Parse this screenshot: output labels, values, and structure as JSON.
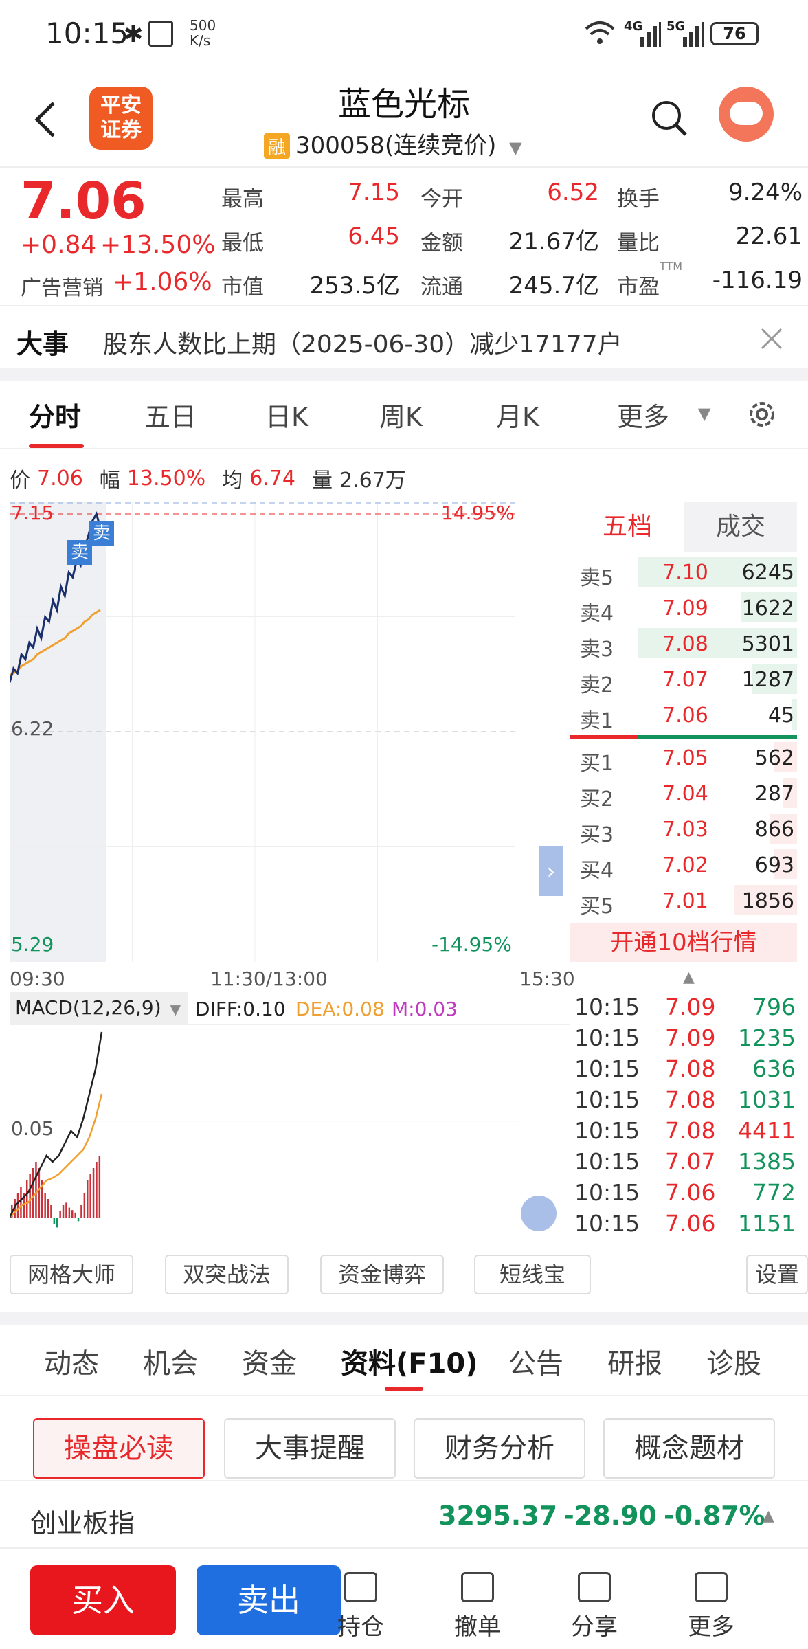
{
  "status_bar": {
    "time": "10:15",
    "net_speed": "500\nK/s",
    "network": "4G 5G",
    "battery": "76"
  },
  "header": {
    "logo_text": "平安\n证券",
    "title": "蓝色光标",
    "margin_badge": "融",
    "code": "300058",
    "trade_state": "(连续竞价)"
  },
  "quote": {
    "price": "7.06",
    "change": "+0.84",
    "change_pct": "+13.50%",
    "sector_name": "广告营销",
    "sector_pct": "+1.06%",
    "stats": [
      {
        "label": "最高",
        "value": "7.15",
        "color": "#e8282b"
      },
      {
        "label": "今开",
        "value": "6.52",
        "color": "#e8282b"
      },
      {
        "label": "换手",
        "value": "9.24%",
        "color": "#222222"
      },
      {
        "label": "最低",
        "value": "6.45",
        "color": "#e8282b"
      },
      {
        "label": "金额",
        "value": "21.67亿",
        "color": "#222222"
      },
      {
        "label": "量比",
        "value": "22.61",
        "color": "#222222"
      },
      {
        "label": "市值",
        "value": "253.5亿",
        "color": "#222222"
      },
      {
        "label": "流通",
        "value": "245.7亿",
        "color": "#222222"
      },
      {
        "label": "市盈",
        "value": "-116.19",
        "color": "#222222"
      }
    ],
    "ttm": "TTM"
  },
  "news": {
    "label": "大事",
    "text": "股东人数比上期（2025-06-30）减少17177户"
  },
  "chart_tabs": {
    "items": [
      "分时",
      "五日",
      "日K",
      "周K",
      "月K",
      "更多"
    ],
    "active": 0
  },
  "info_line": {
    "price_label": "价",
    "price": "7.06",
    "pct_label": "幅",
    "pct": "13.50%",
    "avg_label": "均",
    "avg": "6.74",
    "vol_label": "量",
    "vol": "2.67万"
  },
  "chart_data": {
    "type": "line",
    "y_labels": {
      "top": "7.15",
      "mid": "6.22",
      "bottom": "5.29",
      "top_pct": "14.95%",
      "bottom_pct": "-14.95%"
    },
    "x_labels": [
      "09:30",
      "11:30/13:00",
      "15:30"
    ],
    "ylim": [
      5.29,
      7.15
    ],
    "price": [
      6.43,
      6.49,
      6.47,
      6.55,
      6.53,
      6.6,
      6.58,
      6.66,
      6.62,
      6.71,
      6.69,
      6.78,
      6.74,
      6.84,
      6.8,
      6.9,
      6.88,
      6.95,
      6.93,
      7.0,
      7.06,
      7.12,
      7.15,
      7.09
    ],
    "avg": [
      6.46,
      6.47,
      6.48,
      6.5,
      6.51,
      6.52,
      6.53,
      6.55,
      6.56,
      6.57,
      6.58,
      6.59,
      6.6,
      6.61,
      6.62,
      6.64,
      6.65,
      6.66,
      6.67,
      6.69,
      6.7,
      6.72,
      6.73,
      6.74
    ],
    "annotations": [
      "卖",
      "卖"
    ],
    "macd": {
      "label": "MACD(12,26,9)",
      "diff_label": "DIFF:0.10",
      "dea_label": "DEA:0.08",
      "m_label": "M:0.03",
      "y_label": "0.05",
      "diff": [
        0.0,
        0.01,
        0.015,
        0.02,
        0.03,
        0.04,
        0.05,
        0.045,
        0.05,
        0.06,
        0.07,
        0.065,
        0.08,
        0.1,
        0.12,
        0.15
      ],
      "dea": [
        0.0,
        0.005,
        0.01,
        0.012,
        0.018,
        0.024,
        0.03,
        0.032,
        0.035,
        0.04,
        0.045,
        0.05,
        0.055,
        0.065,
        0.08,
        0.1
      ],
      "bars": [
        0.01,
        0.015,
        0.02,
        0.025,
        0.02,
        0.03,
        0.035,
        0.04,
        0.045,
        0.04,
        0.03,
        0.02,
        0.015,
        0.01,
        -0.005,
        -0.008,
        0.005,
        0.01,
        0.012,
        0.008,
        0.006,
        0.004,
        -0.003,
        0.01,
        0.02,
        0.03,
        0.035,
        0.04,
        0.045,
        0.05
      ]
    }
  },
  "orderbook": {
    "tabs": [
      "五档",
      "成交"
    ],
    "sells": [
      {
        "label": "卖5",
        "price": "7.10",
        "vol": "6245",
        "ratio": 0.7
      },
      {
        "label": "卖4",
        "price": "7.09",
        "vol": "1622",
        "ratio": 0.25
      },
      {
        "label": "卖3",
        "price": "7.08",
        "vol": "5301",
        "ratio": 0.7
      },
      {
        "label": "卖2",
        "price": "7.07",
        "vol": "1287",
        "ratio": 0.2
      },
      {
        "label": "卖1",
        "price": "7.06",
        "vol": "45",
        "ratio": 0.02
      }
    ],
    "buys": [
      {
        "label": "买1",
        "price": "7.05",
        "vol": "562",
        "ratio": 0.1
      },
      {
        "label": "买2",
        "price": "7.04",
        "vol": "287",
        "ratio": 0.06
      },
      {
        "label": "买3",
        "price": "7.03",
        "vol": "866",
        "ratio": 0.12
      },
      {
        "label": "买4",
        "price": "7.02",
        "vol": "693",
        "ratio": 0.1
      },
      {
        "label": "买5",
        "price": "7.01",
        "vol": "1856",
        "ratio": 0.28
      }
    ],
    "upgrade": "开通10档行情"
  },
  "trades": [
    {
      "time": "10:15",
      "price": "7.09",
      "vol": "796",
      "color": "#12935c"
    },
    {
      "time": "10:15",
      "price": "7.09",
      "vol": "1235",
      "color": "#12935c"
    },
    {
      "time": "10:15",
      "price": "7.08",
      "vol": "636",
      "color": "#12935c"
    },
    {
      "time": "10:15",
      "price": "7.08",
      "vol": "1031",
      "color": "#12935c"
    },
    {
      "time": "10:15",
      "price": "7.08",
      "vol": "4411",
      "color": "#e8282b"
    },
    {
      "time": "10:15",
      "price": "7.07",
      "vol": "1385",
      "color": "#12935c"
    },
    {
      "time": "10:15",
      "price": "7.06",
      "vol": "772",
      "color": "#12935c"
    },
    {
      "time": "10:15",
      "price": "7.06",
      "vol": "1151",
      "color": "#12935c"
    }
  ],
  "tools": [
    "网格大师",
    "双突战法",
    "资金博弈",
    "短线宝",
    "设置"
  ],
  "f10_tabs": {
    "items": [
      "动态",
      "机会",
      "资金",
      "资料(F10)",
      "公告",
      "研报",
      "诊股"
    ],
    "active": 3
  },
  "sub_buttons": {
    "items": [
      "操盘必读",
      "大事提醒",
      "财务分析",
      "概念题材"
    ],
    "active": 0
  },
  "index": {
    "name": "创业板指",
    "value": "3295.37",
    "change": "-28.90",
    "pct": "-0.87%"
  },
  "bottom_bar": {
    "buy": "买入",
    "sell": "卖出",
    "items": [
      "持仓",
      "撤单",
      "分享",
      "更多"
    ]
  }
}
